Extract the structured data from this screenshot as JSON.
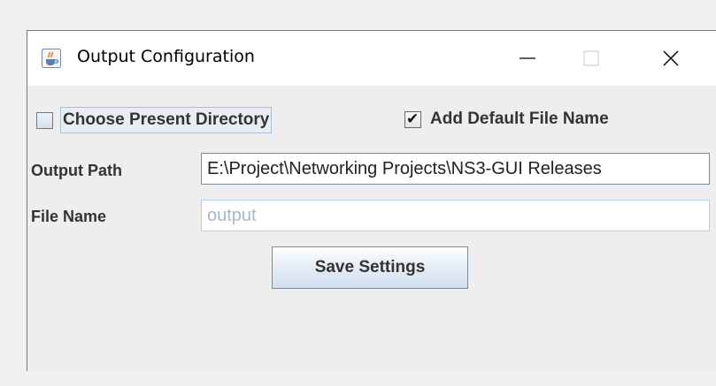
{
  "window": {
    "title": "Output Configuration",
    "icon": "java-cup-icon",
    "controls": {
      "minimize_glyph": "—",
      "maximize_glyph": "☐",
      "close_glyph": "✕"
    }
  },
  "options": {
    "choose_present_directory": {
      "label": "Choose Present Directory",
      "checked": false
    },
    "add_default_file_name": {
      "label": "Add Default File Name",
      "checked": true,
      "check_glyph": "✔"
    }
  },
  "fields": {
    "output_path": {
      "label": "Output Path",
      "value": "E:\\Project\\Networking Projects\\NS3-GUI Releases"
    },
    "file_name": {
      "label": "File Name",
      "value": "output",
      "enabled": false
    }
  },
  "actions": {
    "save_label": "Save Settings"
  }
}
